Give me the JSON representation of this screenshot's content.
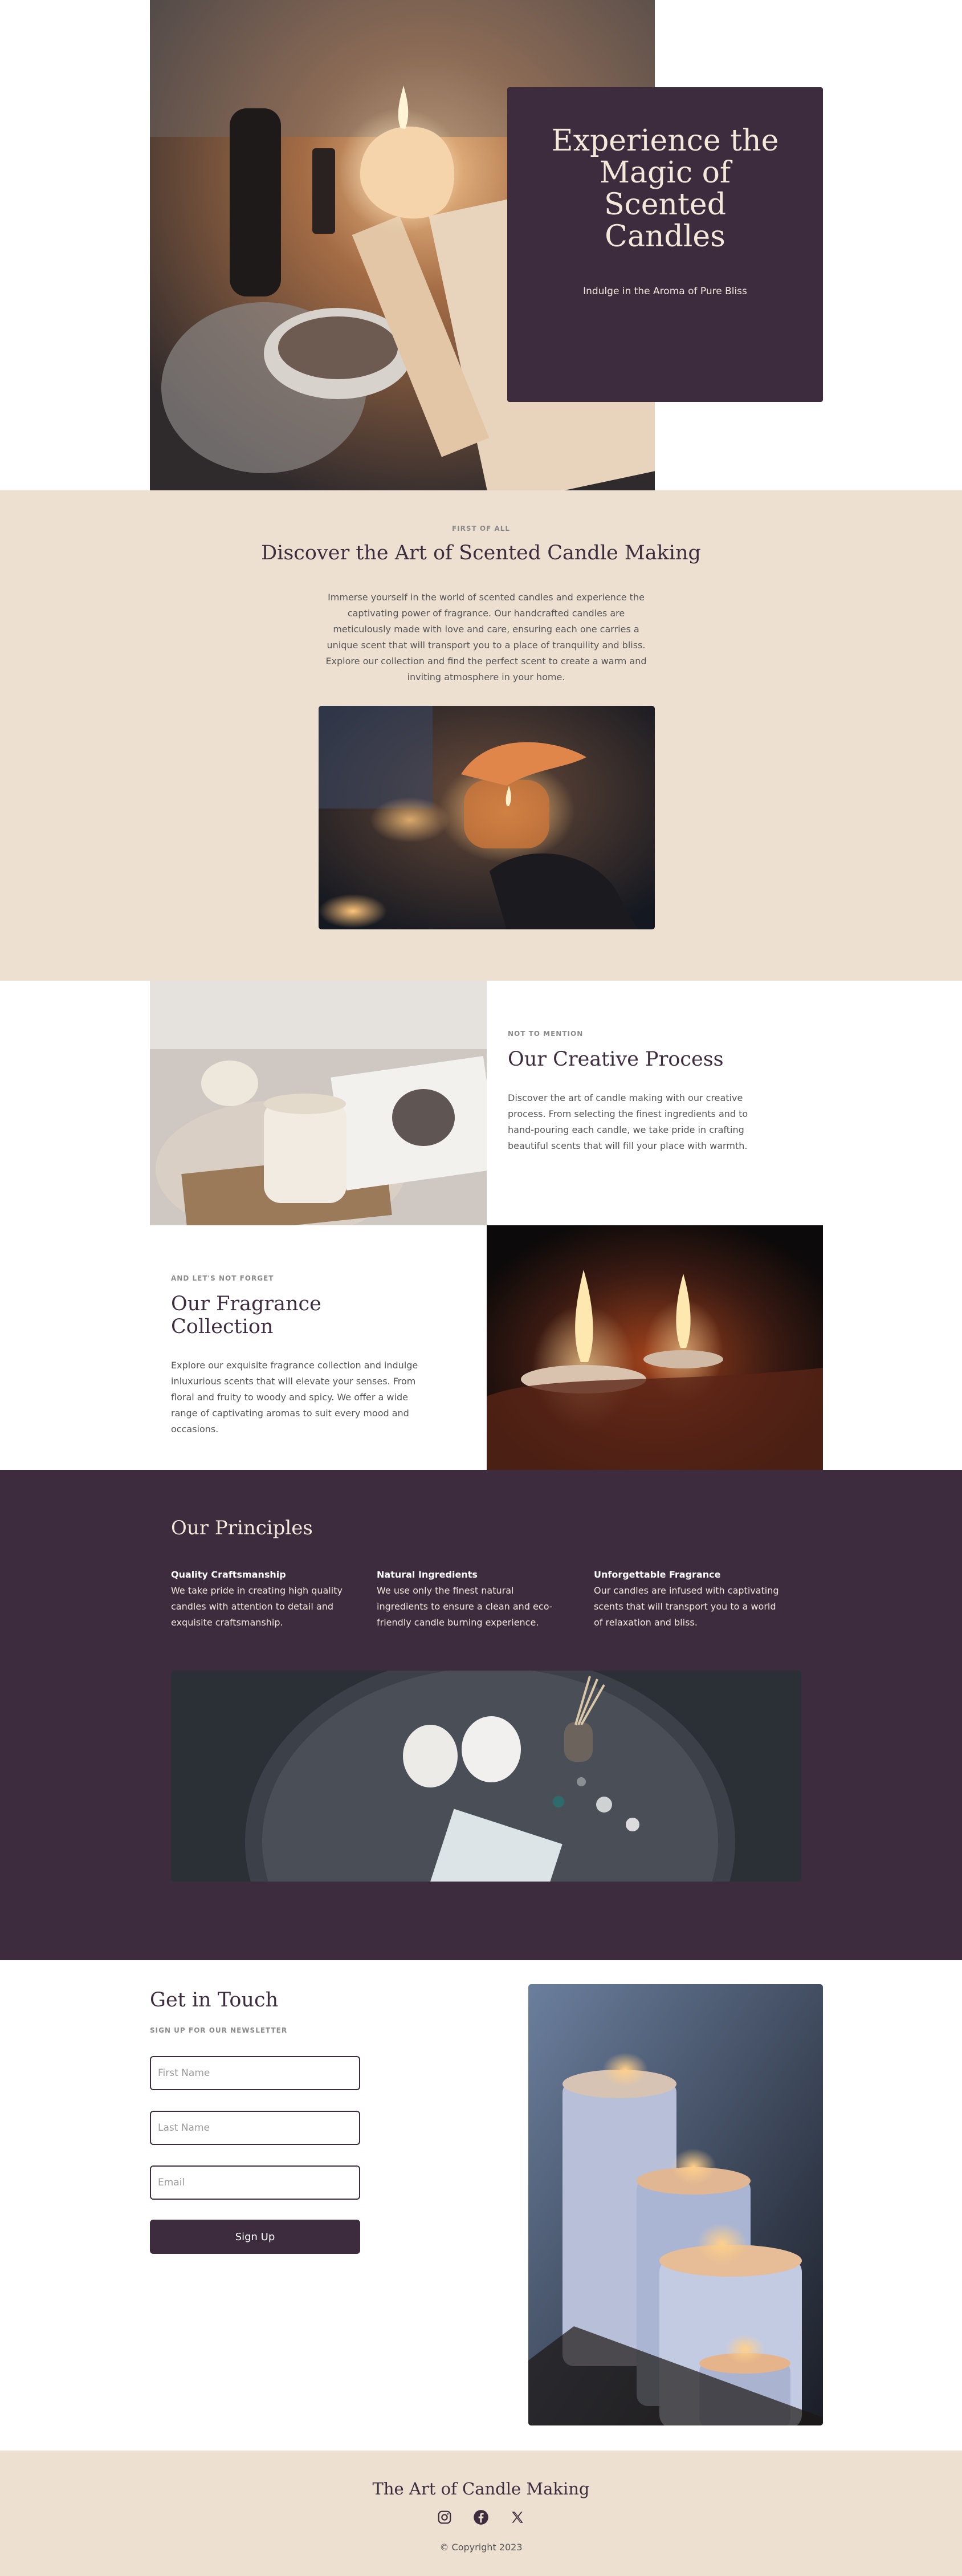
{
  "hero": {
    "title": "Experience the Magic of Scented Candles",
    "subtitle": "Indulge in the Aroma of Pure Bliss"
  },
  "discover": {
    "eyebrow": "FIRST OF ALL",
    "heading": "Discover the Art of Scented Candle Making",
    "body": "Immerse yourself in the world of scented candles and experience the captivating power of fragrance. Our handcrafted candles are meticulously made with love and care, ensuring each one carries a unique scent that will transport you to a place of tranquility and bliss. Explore our collection and find the perfect scent to create a warm and inviting atmosphere in your home."
  },
  "features": [
    {
      "eyebrow": "NOT TO MENTION",
      "heading": "Our Creative Process",
      "body": "Discover the art of candle making with our creative process. From selecting the finest ingredients and to hand-pouring each candle, we take pride in crafting beautiful scents that will fill your place with warmth."
    },
    {
      "eyebrow": "AND LET'S NOT FORGET",
      "heading": "Our Fragrance Collection",
      "body": "Explore our exquisite fragrance collection and indulge inluxurious scents that will elevate your senses. From floral and fruity to woody and spicy. We offer a wide range of captivating aromas to suit every mood and occasions."
    }
  ],
  "principles": {
    "heading": "Our Principles",
    "items": [
      {
        "title": "Quality Craftsmanship",
        "body": "We take pride in creating high quality candles with attention to detail and exquisite craftsmanship."
      },
      {
        "title": "Natural Ingredients",
        "body": "We use only the finest natural ingredients to ensure a clean and eco-friendly candle burning experience."
      },
      {
        "title": "Unforgettable Fragrance",
        "body": "Our candles are infused with captivating scents that will transport you to a world of relaxation and bliss."
      }
    ]
  },
  "contact": {
    "heading": "Get in Touch",
    "eyebrow": "SIGN UP FOR OUR NEWSLETTER",
    "first_name_placeholder": "First Name",
    "last_name_placeholder": "Last Name",
    "email_placeholder": "Email",
    "submit_label": "Sign Up"
  },
  "footer": {
    "title": "The Art of Candle Making",
    "socials": [
      "instagram-icon",
      "facebook-icon",
      "x-icon"
    ],
    "copyright": "© Copyright 2023"
  },
  "colors": {
    "plum": "#3d2c3e",
    "sand": "#ede0d1",
    "cream": "#f4e8da"
  }
}
